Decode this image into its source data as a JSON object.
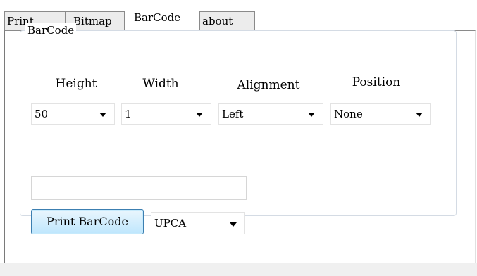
{
  "tabs": [
    {
      "label": "Print"
    },
    {
      "label": "Bitmap"
    },
    {
      "label": "BarCode",
      "active": true
    },
    {
      "label": "about"
    }
  ],
  "group": {
    "title": "BarCode",
    "columns": {
      "height_label": "Height",
      "width_label": "Width",
      "alignment_label": "Alignment",
      "position_label": "Position"
    },
    "combos": {
      "height_value": "50",
      "width_value": "1",
      "alignment_value": "Left",
      "position_value": "None"
    },
    "barcode_text_value": "",
    "print_button_label": "Print BarCode",
    "type_value": "UPCA"
  },
  "colors": {
    "button_border": "#3c7fb1",
    "button_fill": "#bee6fd"
  }
}
